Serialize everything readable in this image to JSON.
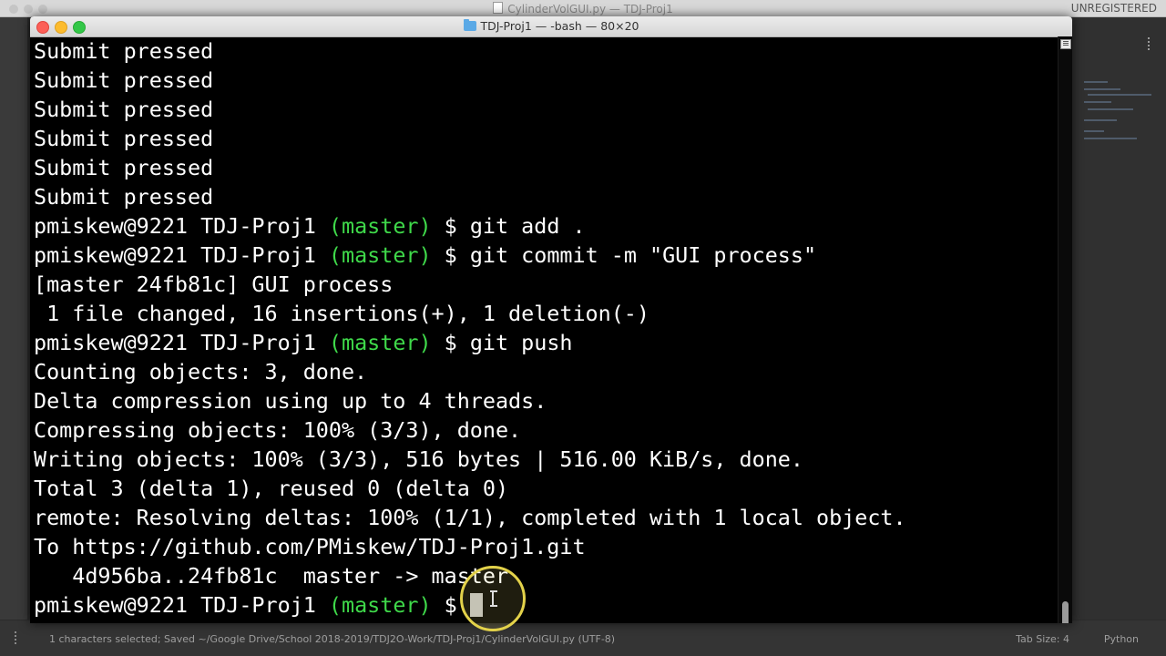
{
  "editor": {
    "title": "CylinderVolGUI.py — TDJ-Proj1",
    "unregistered": "UNREGISTERED",
    "status_left": "1 characters selected; Saved ~/Google Drive/School 2018-2019/TDJ2O-Work/TDJ-Proj1/CylinderVolGUI.py (UTF-8)",
    "tab_size": "Tab Size: 4",
    "syntax": "Python"
  },
  "terminal": {
    "title": "TDJ-Proj1 — -bash — 80×20",
    "prompt_user": "pmiskew@9221 TDJ-Proj1 ",
    "prompt_branch": "(master)",
    "prompt_suffix": " $ ",
    "lines": [
      {
        "type": "out",
        "text": "Submit pressed"
      },
      {
        "type": "out",
        "text": "Submit pressed"
      },
      {
        "type": "out",
        "text": "Submit pressed"
      },
      {
        "type": "out",
        "text": "Submit pressed"
      },
      {
        "type": "out",
        "text": "Submit pressed"
      },
      {
        "type": "out",
        "text": "Submit pressed"
      },
      {
        "type": "cmd",
        "text": "git add ."
      },
      {
        "type": "cmd",
        "text": "git commit -m \"GUI process\""
      },
      {
        "type": "out",
        "text": "[master 24fb81c] GUI process"
      },
      {
        "type": "out",
        "text": " 1 file changed, 16 insertions(+), 1 deletion(-)"
      },
      {
        "type": "cmd",
        "text": "git push"
      },
      {
        "type": "out",
        "text": "Counting objects: 3, done."
      },
      {
        "type": "out",
        "text": "Delta compression using up to 4 threads."
      },
      {
        "type": "out",
        "text": "Compressing objects: 100% (3/3), done."
      },
      {
        "type": "out",
        "text": "Writing objects: 100% (3/3), 516 bytes | 516.00 KiB/s, done."
      },
      {
        "type": "out",
        "text": "Total 3 (delta 1), reused 0 (delta 0)"
      },
      {
        "type": "out",
        "text": "remote: Resolving deltas: 100% (1/1), completed with 1 local object."
      },
      {
        "type": "out",
        "text": "To https://github.com/PMiskew/TDJ-Proj1.git"
      },
      {
        "type": "out",
        "text": "   4d956ba..24fb81c  master -> master"
      },
      {
        "type": "cmd",
        "text": ""
      }
    ]
  },
  "colors": {
    "branch": "#3fd94a",
    "terminal_bg": "#000000",
    "terminal_fg": "#ffffff"
  }
}
